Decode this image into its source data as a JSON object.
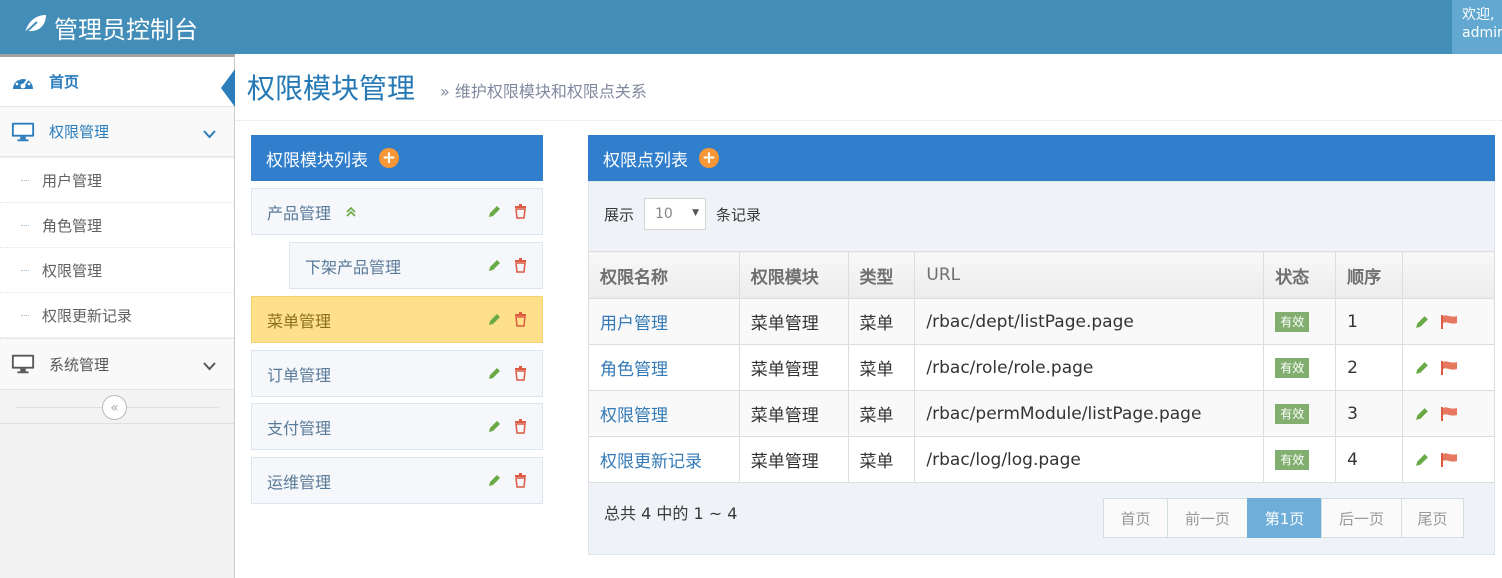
{
  "navbar": {
    "brand": "管理员控制台",
    "welcome": "欢迎,",
    "username": "admin"
  },
  "sidebar": {
    "home": "首页",
    "perm_mgmt": "权限管理",
    "sub_items": [
      "用户管理",
      "角色管理",
      "权限管理",
      "权限更新记录"
    ],
    "sys_mgmt": "系统管理",
    "collapse_glyph": "«"
  },
  "header": {
    "title": "权限模块管理",
    "subtitle_arrow": "»",
    "subtitle": "维护权限模块和权限点关系"
  },
  "module_panel": {
    "title": "权限模块列表",
    "add_glyph": "+",
    "modules": [
      "产品管理",
      "下架产品管理",
      "菜单管理",
      "订单管理",
      "支付管理",
      "运维管理"
    ],
    "expand_glyph": "»"
  },
  "perm_panel": {
    "title": "权限点列表",
    "add_glyph": "+",
    "show_label": "展示",
    "page_size": "10",
    "records_label": "条记录",
    "columns": [
      "权限名称",
      "权限模块",
      "类型",
      "URL",
      "状态",
      "顺序",
      ""
    ],
    "rows": [
      {
        "name": "用户管理",
        "module": "菜单管理",
        "type": "菜单",
        "url": "/rbac/dept/listPage.page",
        "status": "有效",
        "order": "1"
      },
      {
        "name": "角色管理",
        "module": "菜单管理",
        "type": "菜单",
        "url": "/rbac/role/role.page",
        "status": "有效",
        "order": "2"
      },
      {
        "name": "权限管理",
        "module": "菜单管理",
        "type": "菜单",
        "url": "/rbac/permModule/listPage.page",
        "status": "有效",
        "order": "3"
      },
      {
        "name": "权限更新记录",
        "module": "菜单管理",
        "type": "菜单",
        "url": "/rbac/log/log.page",
        "status": "有效",
        "order": "4"
      }
    ],
    "summary": "总共 4 中的 1 ~ 4",
    "pager": {
      "first": "首页",
      "prev": "前一页",
      "current": "第1页",
      "next": "后一页",
      "last": "尾页"
    }
  },
  "colors": {
    "navbar": "#438eb9",
    "accent": "#307ecc",
    "plus": "#f79735",
    "selected_module": "#ffe08a",
    "badge": "#82af6f",
    "edit": "#69aa46",
    "delete": "#dd5a43"
  }
}
